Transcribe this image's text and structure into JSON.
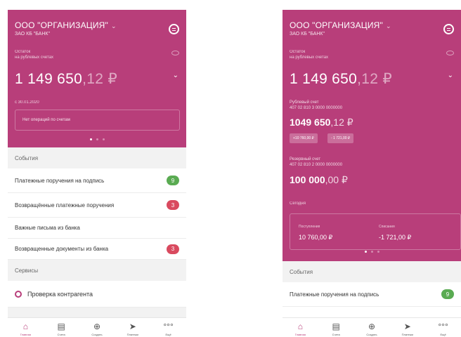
{
  "colors": {
    "accent": "#b83e7a",
    "badge_green": "#5aab52",
    "badge_red": "#d94a5f"
  },
  "left": {
    "org_name": "ООО \"ОРГАНИЗАЦИЯ\"",
    "bank_name": "ЗАО КБ \"БАНК\"",
    "balance_label_1": "Остаток",
    "balance_label_2": "на рублевых счетах",
    "amount_int": "1 149 650",
    "amount_frac": ",12 ₽",
    "since_date": "с 30.01.2020",
    "no_ops": "Нет операций по счетам",
    "events_title": "События",
    "events": [
      {
        "label": "Платежные поручения на подпись",
        "count": "9"
      },
      {
        "label": "Возвращённые платежные поручения",
        "count": "3"
      },
      {
        "label": "Важные письма из банка",
        "count": ""
      },
      {
        "label": "Возвращенные документы из банка",
        "count": "3"
      }
    ],
    "services_title": "Сервисы",
    "service_check": "Проверка контрагента"
  },
  "right": {
    "org_name": "ООО \"ОРГАНИЗАЦИЯ\"",
    "bank_name": "ЗАО КБ \"БАНК\"",
    "balance_label_1": "Остаток",
    "balance_label_2": "на рублевых счетах",
    "amount_int": "1 149 650",
    "amount_frac": ",12 ₽",
    "acct1_label": "Рублевый счет",
    "acct1_number": "407 02 810 3 0000 0000000",
    "acct1_int": "1049 650",
    "acct1_frac": ",12 ₽",
    "chip_in": "+10 760,00 ₽",
    "chip_out": "- 1 721,00 ₽",
    "acct2_label": "Резервный счет",
    "acct2_number": "407 02 810 2 0000 0000000",
    "acct2_int": "100 000",
    "acct2_frac": ",00 ₽",
    "today": "Сегодня",
    "income_label": "Поступления",
    "income_value": "10 760,00 ₽",
    "outcome_label": "Списания",
    "outcome_value": "-1 721,00 ₽",
    "events_title": "События",
    "event1": "Платежные поручения на подпись",
    "event1_count": "9"
  },
  "tabs": [
    {
      "icon": "home-icon",
      "label": "Главная"
    },
    {
      "icon": "document-icon",
      "label": "Счета"
    },
    {
      "icon": "plus-icon",
      "label": "Создать"
    },
    {
      "icon": "send-icon",
      "label": "Платежи"
    },
    {
      "icon": "more-icon",
      "label": "Ещё"
    }
  ]
}
